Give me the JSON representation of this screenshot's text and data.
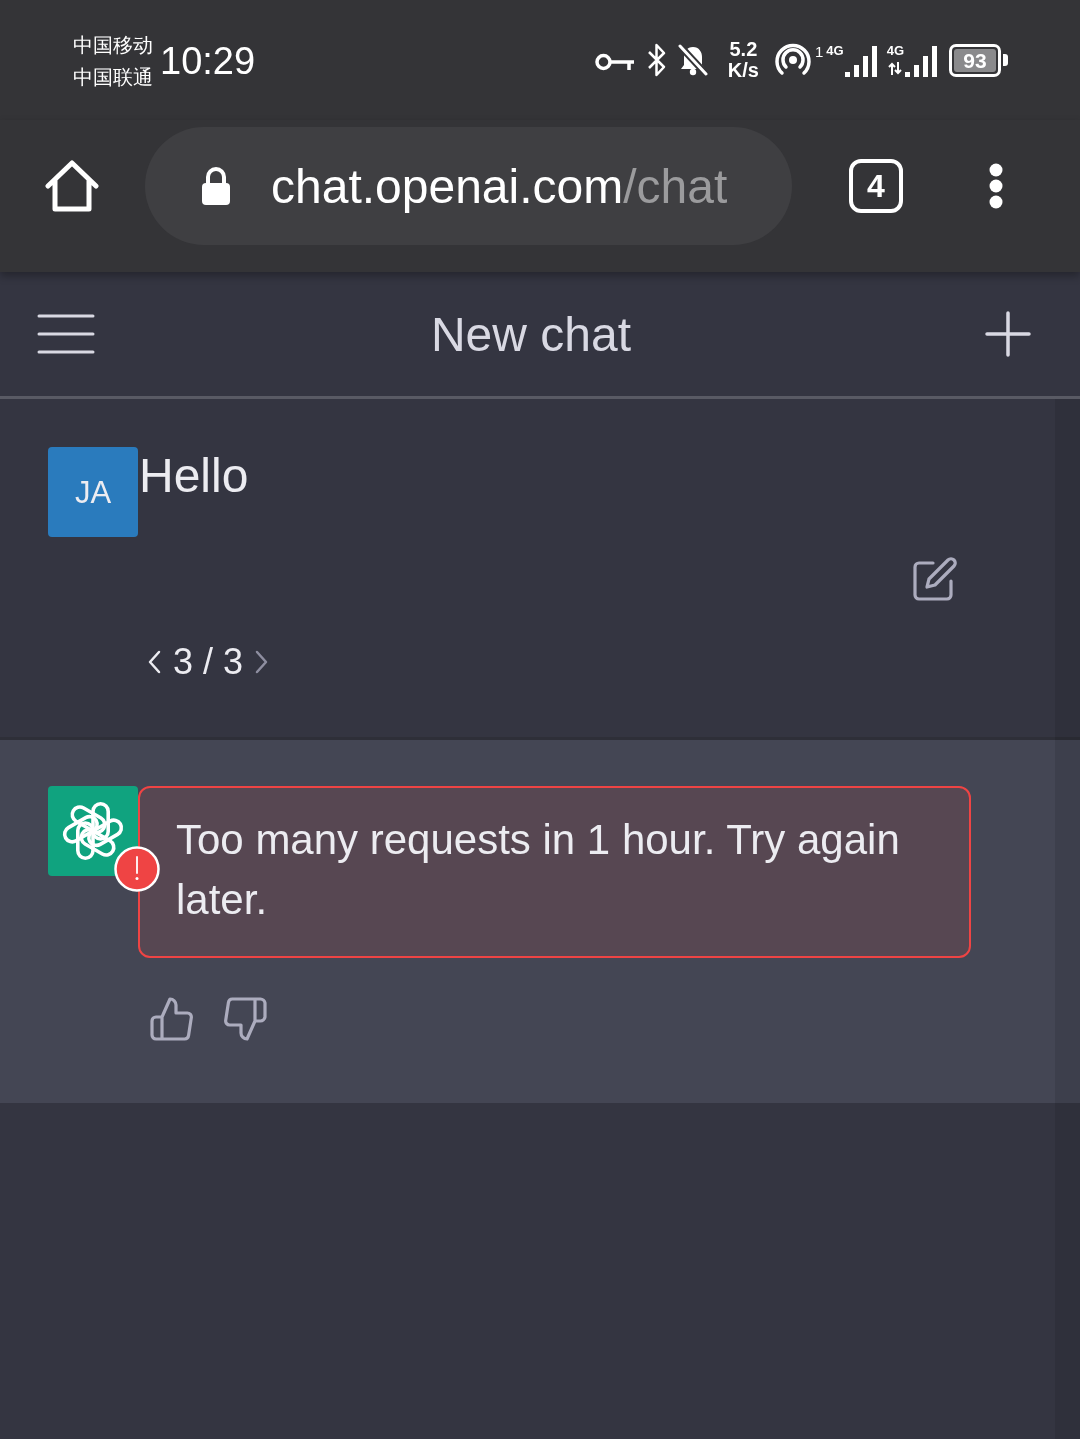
{
  "status_bar": {
    "carriers": [
      "中国移动",
      "中国联通"
    ],
    "time": "10:29",
    "speed": {
      "value": "5.2",
      "unit": "K/s"
    },
    "signals": [
      {
        "sim": "1",
        "network": "4G",
        "transfer": false
      },
      {
        "network": "4G",
        "transfer": true
      }
    ],
    "battery": "93"
  },
  "browser": {
    "url_host": "chat.openai.com",
    "url_path": "/chat",
    "tab_count": "4"
  },
  "header": {
    "title": "New chat"
  },
  "messages": [
    {
      "kind": "user",
      "avatar": "JA",
      "text": "Hello",
      "error": false,
      "pager": {
        "label": "3 / 3",
        "prev": {
          "disabled": false
        },
        "next": {
          "disabled": true
        }
      }
    },
    {
      "kind": "assistant",
      "text": "Too many requests in 1 hour. Try again later.",
      "error": true
    }
  ]
}
